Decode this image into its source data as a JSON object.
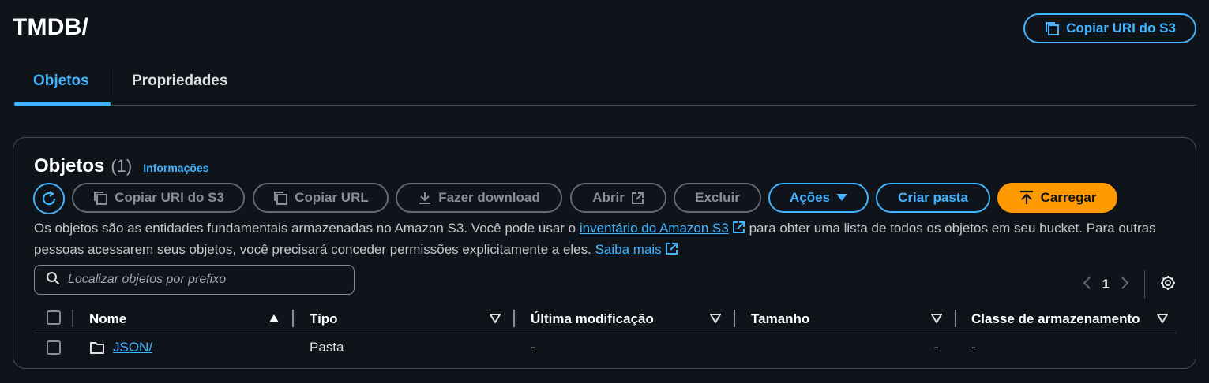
{
  "header": {
    "title": "TMDB/",
    "copy_uri_label": "Copiar URI do S3"
  },
  "tabs": [
    {
      "label": "Objetos",
      "active": true
    },
    {
      "label": "Propriedades",
      "active": false
    }
  ],
  "panel": {
    "title": "Objetos",
    "count": "(1)",
    "info_link": "Informações"
  },
  "toolbar": {
    "copy_uri": "Copiar URI do S3",
    "copy_url": "Copiar URL",
    "download": "Fazer download",
    "open": "Abrir",
    "delete": "Excluir",
    "actions": "Ações",
    "create_folder": "Criar pasta",
    "upload": "Carregar"
  },
  "description": {
    "part1": "Os objetos são as entidades fundamentais armazenadas no Amazon S3. Você pode usar o ",
    "link1": "inventário do Amazon S3",
    "part2": " para obter uma lista de todos os objetos em seu bucket. Para outras pessoas acessarem seus objetos, você precisará conceder permissões explicitamente a eles. ",
    "link2": "Saiba mais"
  },
  "search": {
    "placeholder": "Localizar objetos por prefixo"
  },
  "pagination": {
    "current_page": "1"
  },
  "table": {
    "columns": [
      "Nome",
      "Tipo",
      "Última modificação",
      "Tamanho",
      "Classe de armazenamento"
    ],
    "rows": [
      {
        "name": "JSON/",
        "type": "Pasta",
        "modified": "-",
        "size": "-",
        "storage_class": "-"
      }
    ]
  },
  "colors": {
    "background": "#0f141a",
    "accent": "#42b4ff",
    "primary_button": "#ff9900",
    "border": "#414d5c"
  },
  "icons": [
    "copy-icon",
    "refresh-icon",
    "download-icon",
    "external-link-icon",
    "caret-down-icon",
    "upload-icon",
    "search-icon",
    "chevron-left-icon",
    "chevron-right-icon",
    "gear-icon",
    "sort-asc-icon",
    "sort-desc-icon",
    "folder-icon"
  ]
}
